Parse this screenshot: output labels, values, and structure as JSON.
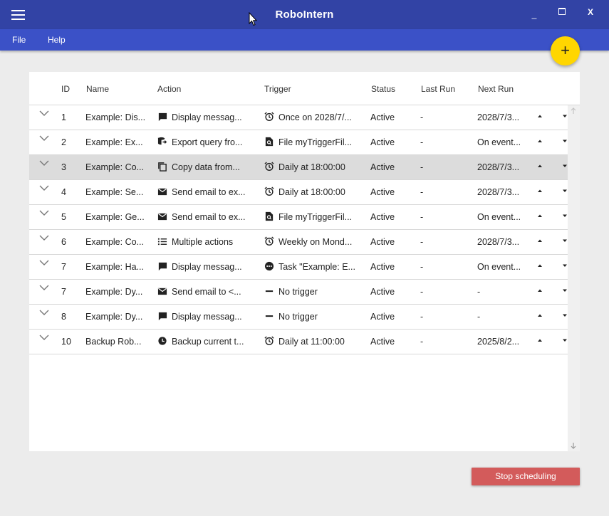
{
  "app": {
    "title": "RoboIntern",
    "window_controls": {
      "minimize": "_",
      "close": "X"
    }
  },
  "menu": [
    "File",
    "Help"
  ],
  "fab_label": "+",
  "table": {
    "columns": [
      "ID",
      "Name",
      "Action",
      "Trigger",
      "Status",
      "Last Run",
      "Next Run"
    ],
    "rows": [
      {
        "id": "1",
        "name": "Example: Dis...",
        "action_icon": "message-icon",
        "action": "Display messag...",
        "trigger_icon": "alarm-icon",
        "trigger": "Once on 2028/7/...",
        "status": "Active",
        "last_run": "-",
        "next_run": "2028/7/3..."
      },
      {
        "id": "2",
        "name": "Example: Ex...",
        "action_icon": "database-export-icon",
        "action": "Export query fro...",
        "trigger_icon": "file-search-icon",
        "trigger": "File myTriggerFil...",
        "status": "Active",
        "last_run": "-",
        "next_run": "On event..."
      },
      {
        "id": "3",
        "name": "Example: Co...",
        "action_icon": "copy-icon",
        "action": "Copy data from...",
        "trigger_icon": "alarm-icon",
        "trigger": "Daily at 18:00:00",
        "status": "Active",
        "last_run": "-",
        "next_run": "2028/7/3..."
      },
      {
        "id": "4",
        "name": "Example: Se...",
        "action_icon": "email-icon",
        "action": "Send email to ex...",
        "trigger_icon": "alarm-icon",
        "trigger": "Daily at 18:00:00",
        "status": "Active",
        "last_run": "-",
        "next_run": "2028/7/3..."
      },
      {
        "id": "5",
        "name": "Example: Ge...",
        "action_icon": "email-icon",
        "action": "Send email to ex...",
        "trigger_icon": "file-search-icon",
        "trigger": "File myTriggerFil...",
        "status": "Active",
        "last_run": "-",
        "next_run": "On event..."
      },
      {
        "id": "6",
        "name": "Example: Co...",
        "action_icon": "list-icon",
        "action": "Multiple actions",
        "trigger_icon": "alarm-icon",
        "trigger": "Weekly on Mond...",
        "status": "Active",
        "last_run": "-",
        "next_run": "2028/7/3..."
      },
      {
        "id": "7",
        "name": "Example: Ha...",
        "action_icon": "message-icon",
        "action": "Display messag...",
        "trigger_icon": "task-event-icon",
        "trigger": "Task \"Example: E...",
        "status": "Active",
        "last_run": "-",
        "next_run": "On event..."
      },
      {
        "id": "7",
        "name": "Example: Dy...",
        "action_icon": "email-icon",
        "action": "Send email to <...",
        "trigger_icon": "no-trigger-icon",
        "trigger": "No trigger",
        "status": "Active",
        "last_run": "-",
        "next_run": "-"
      },
      {
        "id": "8",
        "name": "Example: Dy...",
        "action_icon": "message-icon",
        "action": "Display messag...",
        "trigger_icon": "no-trigger-icon",
        "trigger": "No trigger",
        "status": "Active",
        "last_run": "-",
        "next_run": "-"
      },
      {
        "id": "10",
        "name": "Backup Rob...",
        "action_icon": "backup-icon",
        "action": "Backup current t...",
        "trigger_icon": "alarm-icon",
        "trigger": "Daily at 11:00:00",
        "status": "Active",
        "last_run": "-",
        "next_run": "2025/8/2..."
      }
    ],
    "selected_row_index": 2
  },
  "footer": {
    "stop_button": "Stop scheduling"
  },
  "colors": {
    "titlebar": "#3243a5",
    "menubar": "#3b51c7",
    "fab": "#ffd600",
    "stop_button": "#d35b5b",
    "selected_row": "#dcdcdc"
  }
}
